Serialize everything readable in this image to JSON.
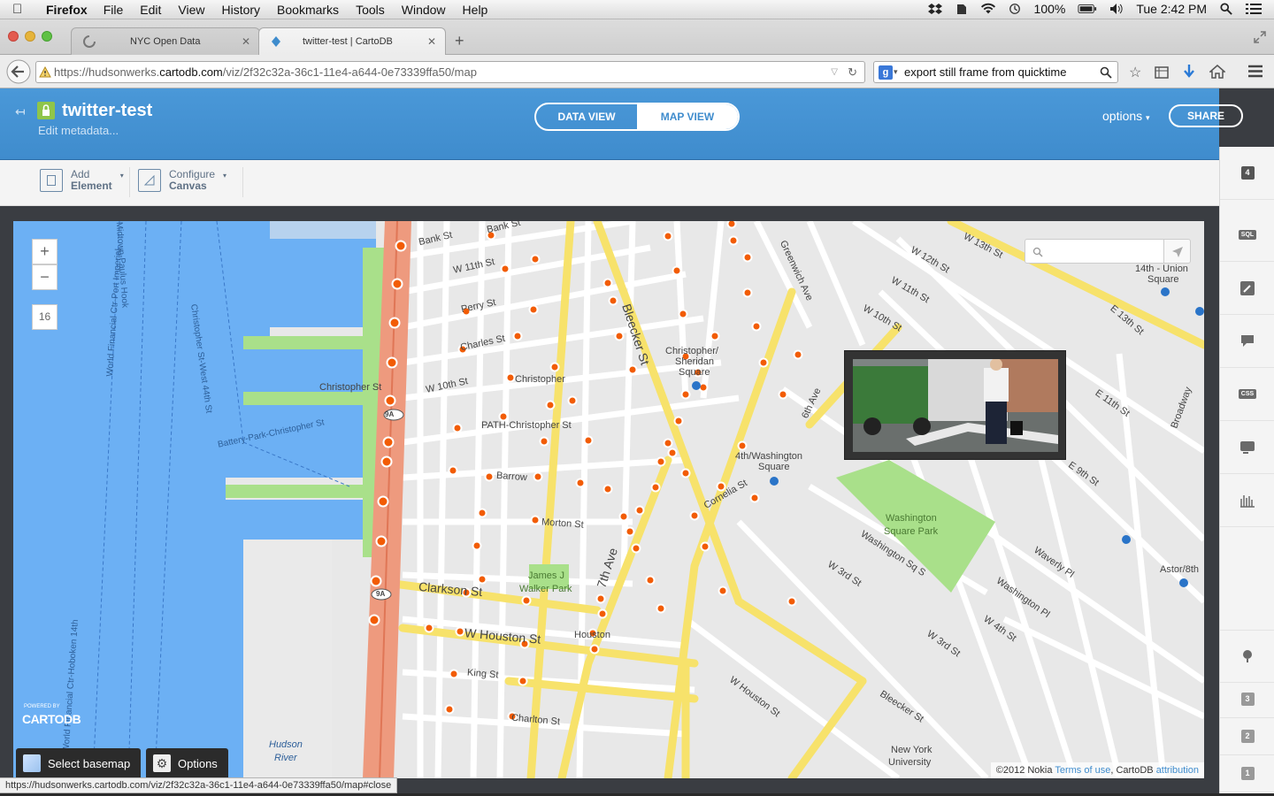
{
  "menubar": {
    "app": "Firefox",
    "items": [
      "File",
      "Edit",
      "View",
      "History",
      "Bookmarks",
      "Tools",
      "Window",
      "Help"
    ],
    "battery": "100%",
    "clock": "Tue 2:42 PM"
  },
  "tabs": [
    {
      "label": "NYC Open Data"
    },
    {
      "label": "twitter-test | CartoDB"
    }
  ],
  "url": {
    "prefix": "https://hudsonwerks.",
    "domain": "cartodb.com",
    "path": "/viz/2f32c32a-36c1-11e4-a644-0e73339ffa50/map"
  },
  "search": {
    "value": "export still frame from quicktime"
  },
  "header": {
    "title": "twitter-test",
    "meta": "Edit metadata...",
    "data_view": "DATA VIEW",
    "map_view": "MAP VIEW",
    "options": "options",
    "share": "SHARE"
  },
  "toolbar": {
    "add": {
      "line1": "Add",
      "line2": "Element"
    },
    "configure": {
      "line1": "Configure",
      "line2": "Canvas"
    }
  },
  "map": {
    "zoom_in": "+",
    "zoom_out": "−",
    "zoom_level": "16",
    "attribution": {
      "a": "©2012 Nokia",
      "b": "Terms of use",
      "c": ", CartoDB",
      "d": "attribution"
    },
    "logo": {
      "small": "POWERED BY",
      "big": "CARTODB"
    },
    "select_basemap": "Select basemap",
    "options": "Options",
    "labels": [
      {
        "id": "bank1",
        "text": "Bank St"
      },
      {
        "id": "bank2",
        "text": "Bank St"
      },
      {
        "id": "w11",
        "text": "W 11th St"
      },
      {
        "id": "perry",
        "text": "Perry St"
      },
      {
        "id": "charles",
        "text": "Charles St"
      },
      {
        "id": "w10",
        "text": "W 10th St"
      },
      {
        "id": "christ1",
        "text": "Christopher St"
      },
      {
        "id": "christ2",
        "text": "Christopher"
      },
      {
        "id": "path",
        "text": "PATH-Christopher St"
      },
      {
        "id": "barrow",
        "text": "Barrow"
      },
      {
        "id": "morton",
        "text": "Morton St"
      },
      {
        "id": "james",
        "text": "James J"
      },
      {
        "id": "walker",
        "text": "Walker Park"
      },
      {
        "id": "clarkson",
        "text": "Clarkson St"
      },
      {
        "id": "houston",
        "text": "W Houston St"
      },
      {
        "id": "houston2",
        "text": "Houston"
      },
      {
        "id": "king",
        "text": "King St"
      },
      {
        "id": "charlton",
        "text": "Charlton St"
      },
      {
        "id": "bleecker1",
        "text": "Bleecker St"
      },
      {
        "id": "seventh",
        "text": "7th Ave"
      },
      {
        "id": "sixth",
        "text": "6th Ave"
      },
      {
        "id": "csq1",
        "text": "Christopher/"
      },
      {
        "id": "csq2",
        "text": "Sheridan"
      },
      {
        "id": "csq3",
        "text": "Square"
      },
      {
        "id": "wash4",
        "text": "4th/Washington"
      },
      {
        "id": "wash4b",
        "text": "Square"
      },
      {
        "id": "cornelia",
        "text": "Cornelia St"
      },
      {
        "id": "wsp1",
        "text": "Washington"
      },
      {
        "id": "wsp2",
        "text": "Square Park"
      },
      {
        "id": "wsqs",
        "text": "Washington Sq S"
      },
      {
        "id": "w3rd",
        "text": "W 3rd St"
      },
      {
        "id": "bleecker2",
        "text": "Bleecker St"
      },
      {
        "id": "whouston2",
        "text": "W Houston St"
      },
      {
        "id": "nyu1",
        "text": "New York"
      },
      {
        "id": "nyu2",
        "text": "University"
      },
      {
        "id": "w13",
        "text": "W 13th St"
      },
      {
        "id": "w12",
        "text": "W 12th St"
      },
      {
        "id": "w11b",
        "text": "W 11th St"
      },
      {
        "id": "w10b",
        "text": "W 10th St"
      },
      {
        "id": "e13",
        "text": "E 13th St"
      },
      {
        "id": "e11",
        "text": "E 11th St"
      },
      {
        "id": "e9",
        "text": "E 9th St"
      },
      {
        "id": "broadway",
        "text": "Broadway"
      },
      {
        "id": "waverly",
        "text": "Waverly Pl"
      },
      {
        "id": "washpl",
        "text": "Washington Pl"
      },
      {
        "id": "w4th",
        "text": "W 4th St"
      },
      {
        "id": "w3rd2",
        "text": "W 3rd St"
      },
      {
        "id": "union1",
        "text": "14th - Union"
      },
      {
        "id": "union2",
        "text": "Square"
      },
      {
        "id": "astor",
        "text": "Astor/8th"
      },
      {
        "id": "greenwich",
        "text": "Greenwich Ave"
      },
      {
        "id": "hudson1",
        "text": "Hudson"
      },
      {
        "id": "hudson2",
        "text": "River"
      },
      {
        "id": "battery",
        "text": "Battery-Park-Christopher St"
      },
      {
        "id": "route1",
        "text": "9A"
      },
      {
        "id": "route2",
        "text": "9A"
      },
      {
        "id": "route3",
        "text": "9A"
      },
      {
        "id": "ferry1",
        "text": "Midtown-Paulus Hook"
      },
      {
        "id": "ferry2",
        "text": "World Financial Ctr-Port Imperial"
      },
      {
        "id": "ferry3",
        "text": "Christopher St-West 44th St"
      },
      {
        "id": "ferry4",
        "text": "World Financial Ctr-Hoboken 14th"
      }
    ]
  },
  "right_panel": {
    "badges": [
      "4",
      "3",
      "2",
      "1"
    ],
    "sql": "SQL",
    "css": "CSS"
  },
  "status": "https://hudsonwerks.cartodb.com/viz/2f32c32a-36c1-11e4-a644-0e73339ffa50/map#close"
}
